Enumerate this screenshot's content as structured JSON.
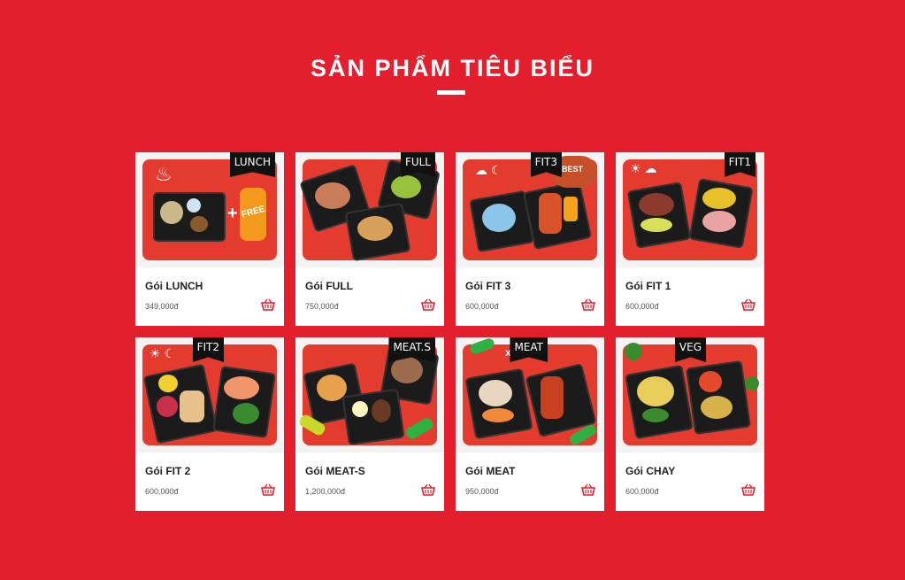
{
  "section": {
    "title": "SẢN PHẨM TIÊU BIỂU"
  },
  "products": [
    {
      "name": "Gói LUNCH",
      "price": "349,000đ",
      "tag": "LUNCH",
      "extra": "FREE"
    },
    {
      "name": "Gói FULL",
      "price": "750,000đ",
      "tag": "FULL"
    },
    {
      "name": "Gói FIT 3",
      "price": "600,000đ",
      "tag": "FIT3",
      "extra": "BEST"
    },
    {
      "name": "Gói FIT 1",
      "price": "600,000đ",
      "tag": "FIT1"
    },
    {
      "name": "Gói FIT 2",
      "price": "600,000đ",
      "tag": "FIT2"
    },
    {
      "name": "Gói MEAT-S",
      "price": "1,200,000đ",
      "tag": "MEAT.S"
    },
    {
      "name": "Gói MEAT",
      "price": "950,000đ",
      "tag": "MEAT",
      "extra": "x2"
    },
    {
      "name": "Gói CHAY",
      "price": "600,000đ",
      "tag": "VEG"
    }
  ],
  "colors": {
    "background": "#e31e2d",
    "cart": "#e31e2d"
  },
  "icons": {
    "cart": "basket-icon"
  }
}
